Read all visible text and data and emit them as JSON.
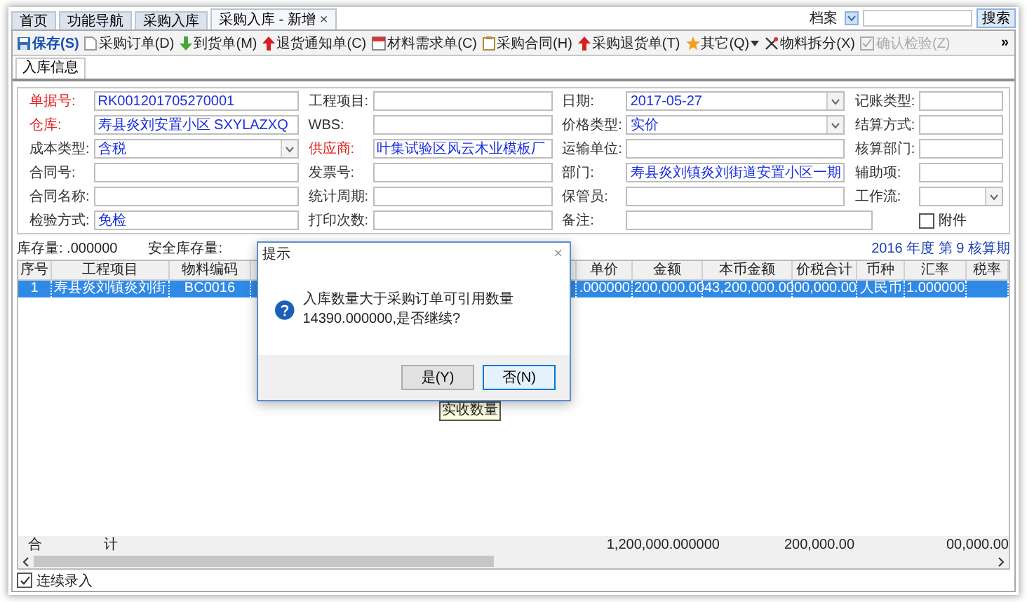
{
  "tabs": [
    {
      "label": "首页",
      "selected": false
    },
    {
      "label": "功能导航",
      "selected": false
    },
    {
      "label": "采购入库",
      "selected": false
    },
    {
      "label": "采购入库 - 新增",
      "selected": true,
      "close": "×"
    }
  ],
  "search": {
    "scope": "档案",
    "button": "搜索"
  },
  "toolbar": {
    "items": [
      {
        "label": "保存(S)",
        "kind": "save",
        "primary": true,
        "disabled": false
      },
      {
        "label": "采购订单(D)",
        "kind": "document",
        "primary": false,
        "disabled": false
      },
      {
        "label": "到货单(M)",
        "kind": "down",
        "primary": false,
        "disabled": false
      },
      {
        "label": "退货通知单(C)",
        "kind": "up",
        "primary": false,
        "disabled": false
      },
      {
        "label": "材料需求单(C)",
        "kind": "calendar",
        "primary": false,
        "disabled": false
      },
      {
        "label": "采购合同(H)",
        "kind": "clipboard",
        "primary": false,
        "disabled": false
      },
      {
        "label": "采购退货单(T)",
        "kind": "up",
        "primary": false,
        "disabled": false
      },
      {
        "label": "其它(Q)",
        "kind": "star",
        "primary": false,
        "disabled": false,
        "dropdown": true
      },
      {
        "label": "物料拆分(X)",
        "kind": "scissors",
        "primary": false,
        "disabled": false
      },
      {
        "label": "确认检验(Z)",
        "kind": "check",
        "primary": false,
        "disabled": true
      }
    ],
    "overflow": "»"
  },
  "subtabs": [
    {
      "label": "入库信息",
      "selected": true
    }
  ],
  "form": {
    "rows": [
      [
        {
          "label": "单据号:",
          "value": "RK001201705270001",
          "required": true,
          "kind": "text"
        },
        {
          "label": "工程项目:",
          "kind": "text",
          "required": false
        },
        {
          "label": "日期:",
          "value": "2017-05-27",
          "kind": "select",
          "required": false
        },
        {
          "label": "记账类型:",
          "kind": "text",
          "required": false
        }
      ],
      [
        {
          "label": "仓库:",
          "value": "寿县炎刘安置小区  SXYLAZXQ",
          "required": true,
          "kind": "text"
        },
        {
          "label": "WBS:",
          "kind": "text",
          "required": false
        },
        {
          "label": "价格类型:",
          "value": "实价",
          "kind": "select",
          "required": false
        },
        {
          "label": "结算方式:",
          "kind": "text",
          "required": false
        }
      ],
      [
        {
          "label": "成本类型:",
          "value": "含税",
          "kind": "select",
          "required": false
        },
        {
          "label": "供应商:",
          "value": "叶集试验区风云木业模板厂",
          "kind": "text",
          "required": true
        },
        {
          "label": "运输单位:",
          "kind": "text",
          "required": false
        },
        {
          "label": "核算部门:",
          "kind": "text",
          "required": false
        }
      ],
      [
        {
          "label": "合同号:",
          "kind": "text",
          "required": false
        },
        {
          "label": "发票号:",
          "kind": "text",
          "required": false
        },
        {
          "label": "部门:",
          "value": "寿县炎刘镇炎刘街道安置小区一期",
          "kind": "text",
          "required": false
        },
        {
          "label": "辅助项:",
          "kind": "text",
          "required": false
        }
      ],
      [
        {
          "label": "合同名称:",
          "kind": "text",
          "required": false
        },
        {
          "label": "统计周期:",
          "kind": "text",
          "required": false
        },
        {
          "label": "保管员:",
          "kind": "text",
          "required": false
        },
        {
          "label": "工作流:",
          "kind": "select",
          "required": false
        }
      ],
      [
        {
          "label": "检验方式:",
          "value": "免检",
          "kind": "text",
          "required": false
        },
        {
          "label": "打印次数:",
          "kind": "text",
          "required": false
        },
        {
          "label": "备注:",
          "kind": "wide",
          "required": false
        },
        {
          "label": "附件",
          "kind": "checkbox",
          "checked": false
        }
      ]
    ]
  },
  "info": {
    "stock": "库存量: .000000",
    "safety_stock": "安全库存量:",
    "period": "2016 年度 第 9 核算期"
  },
  "table": {
    "columns": [
      "序号",
      "工程项目",
      "物料编码",
      "单价",
      "金额",
      "本币金额",
      "价税合计",
      "币种",
      "汇率",
      "税率"
    ],
    "rows": [
      {
        "selected": true,
        "cells": [
          "1",
          "寿县炎刘镇炎刘街",
          "BC0016",
          ".000000",
          "200,000.00",
          "43,200,000.00",
          "00,000.00",
          "人民币",
          "1.000000"
        ]
      }
    ],
    "totals": {
      "label": "合",
      "label_2": "计",
      "quantity": "1,200,000.000000",
      "amount": "200,000.00",
      "tax_total": "00,000.00"
    },
    "tooltip": "实收数量"
  },
  "footer": {
    "label": "连续录入",
    "checked": true
  },
  "dialog": {
    "title": "提示",
    "close": "×",
    "message": "入库数量大于采购订单可引用数量 14390.000000,是否继续?",
    "buttons": [
      {
        "label": "是(Y)",
        "selected": false
      },
      {
        "label": "否(N)",
        "selected": true
      }
    ]
  }
}
